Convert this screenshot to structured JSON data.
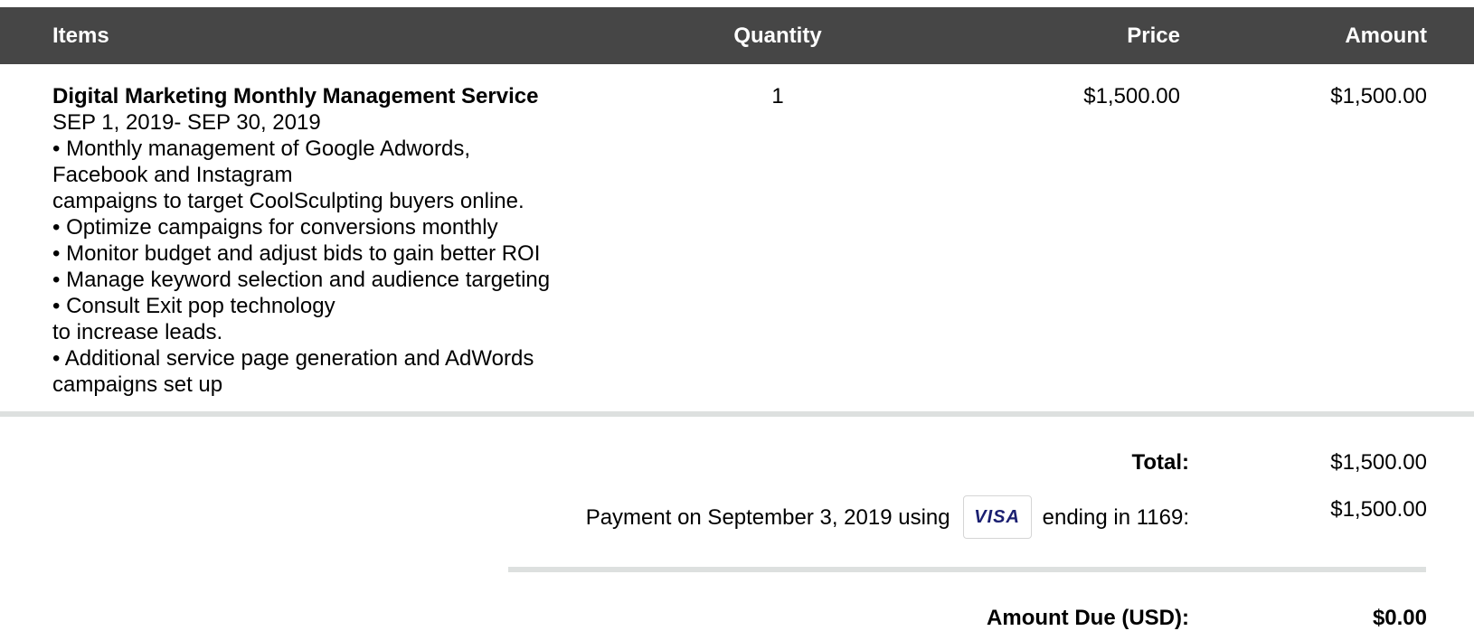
{
  "table": {
    "headers": {
      "items": "Items",
      "quantity": "Quantity",
      "price": "Price",
      "amount": "Amount"
    },
    "rows": [
      {
        "title": "Digital Marketing Monthly Management Service",
        "description": [
          "SEP 1, 2019- SEP 30, 2019",
          "• Monthly management of Google Adwords,",
          "Facebook and Instagram",
          "campaigns to target CoolSculpting buyers online.",
          "• Optimize campaigns for conversions monthly",
          "• Monitor budget and adjust bids to gain better ROI",
          "• Manage keyword selection and audience targeting",
          "• Consult Exit pop technology",
          "to increase leads.",
          "• Additional service page generation and AdWords",
          "campaigns set up"
        ],
        "quantity": "1",
        "price": "$1,500.00",
        "amount": "$1,500.00"
      }
    ]
  },
  "summary": {
    "total_label": "Total:",
    "total_value": "$1,500.00",
    "payment_prefix": "Payment on September 3, 2019 using",
    "card_brand": "VISA",
    "payment_suffix": "ending in 1169:",
    "payment_value": "$1,500.00",
    "amount_due_label": "Amount Due (USD):",
    "amount_due_value": "$0.00"
  },
  "colors": {
    "header_bg": "#464646",
    "separator": "#dde0df",
    "visa_blue": "#1a1f71"
  }
}
